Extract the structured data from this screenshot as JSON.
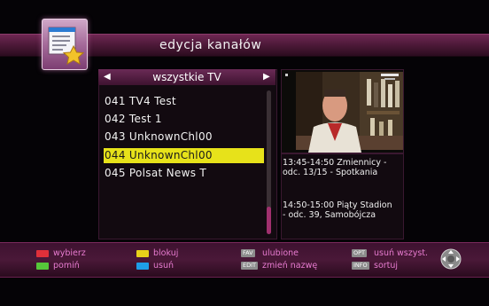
{
  "header": {
    "title": "edycja kanałów"
  },
  "list": {
    "filter_label": "wszystkie TV",
    "channels": [
      {
        "label": "041 TV4 Test"
      },
      {
        "label": "042 Test 1"
      },
      {
        "label": "043 UnknownChl00"
      },
      {
        "label": "044 UnknownChl00"
      },
      {
        "label": "045 Polsat News T"
      }
    ],
    "selected_index": 3
  },
  "epg": {
    "event1": "13:45-14:50  Zmiennicy -\nodc. 13/15 - Spotkania",
    "event2": "14:50-15:00  Piąty Stadion\n- odc. 39, Samobójcza"
  },
  "footer": {
    "red": "wybierz",
    "green": "pomiń",
    "yellow": "blokuj",
    "blue": "usuń",
    "fav_key": "FAV",
    "fav": "ulubione",
    "edit_key": "EDIT",
    "edit": "zmień nazwę",
    "opt_key": "OPT",
    "opt": "usuń wszyst.",
    "info_key": "INFO",
    "info": "sortuj"
  },
  "colors": {
    "accent": "#6e2752",
    "selected": "#e7e21a",
    "legend_text": "#e87bd0",
    "red": "#e0303a",
    "green": "#56c63a",
    "yellow": "#e8d21a",
    "blue": "#1e9ee8"
  }
}
